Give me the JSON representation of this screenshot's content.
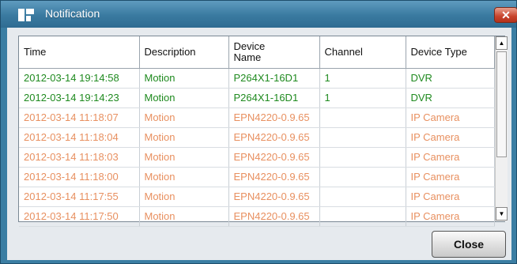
{
  "window": {
    "title": "Notification",
    "close_glyph": "✕"
  },
  "table": {
    "columns": [
      "Time",
      "Description",
      "Device\nName",
      "Channel",
      "Device Type"
    ],
    "rows": [
      {
        "time": "2012-03-14 19:14:58",
        "description": "Motion",
        "device_name": "P264X1-16D1",
        "channel": "1",
        "device_type": "DVR",
        "status": "dvr"
      },
      {
        "time": "2012-03-14 19:14:23",
        "description": "Motion",
        "device_name": "P264X1-16D1",
        "channel": "1",
        "device_type": "DVR",
        "status": "dvr"
      },
      {
        "time": "2012-03-14 11:18:07",
        "description": "Motion",
        "device_name": "EPN4220-0.9.65",
        "channel": "",
        "device_type": "IP Camera",
        "status": "ipcam"
      },
      {
        "time": "2012-03-14 11:18:04",
        "description": "Motion",
        "device_name": "EPN4220-0.9.65",
        "channel": "",
        "device_type": "IP Camera",
        "status": "ipcam"
      },
      {
        "time": "2012-03-14 11:18:03",
        "description": "Motion",
        "device_name": "EPN4220-0.9.65",
        "channel": "",
        "device_type": "IP Camera",
        "status": "ipcam"
      },
      {
        "time": "2012-03-14 11:18:00",
        "description": "Motion",
        "device_name": "EPN4220-0.9.65",
        "channel": "",
        "device_type": "IP Camera",
        "status": "ipcam"
      },
      {
        "time": "2012-03-14 11:17:55",
        "description": "Motion",
        "device_name": "EPN4220-0.9.65",
        "channel": "",
        "device_type": "IP Camera",
        "status": "ipcam"
      },
      {
        "time": "2012-03-14 11:17:50",
        "description": "Motion",
        "device_name": "EPN4220-0.9.65",
        "channel": "",
        "device_type": "IP Camera",
        "status": "ipcam"
      }
    ]
  },
  "scrollbar": {
    "up_glyph": "▲",
    "down_glyph": "▼"
  },
  "footer": {
    "close_label": "Close"
  },
  "colors": {
    "dvr_text": "#1f8a1f",
    "ipcam_text": "#e89060",
    "title_bar": "#3a7aa0"
  }
}
